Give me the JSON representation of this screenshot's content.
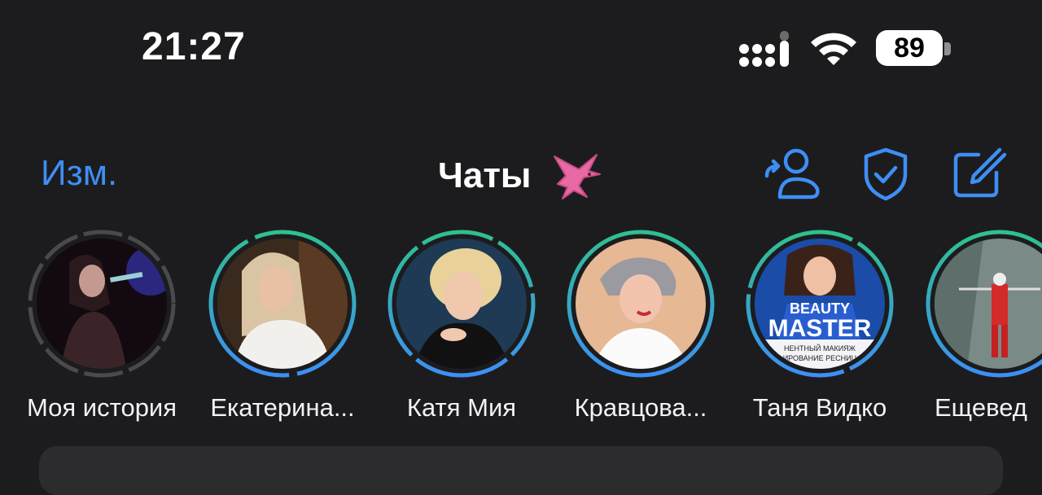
{
  "status": {
    "time": "21:27",
    "battery": "89",
    "signal_icon": "cellular-signal-icon",
    "wifi_icon": "wifi-icon"
  },
  "header": {
    "edit_label": "Изм.",
    "title": "Чаты",
    "title_emoji": "dragon-icon",
    "actions": [
      "add-contact-icon",
      "shield-check-icon",
      "compose-icon"
    ]
  },
  "colors": {
    "accent": "#3d8ff5",
    "background": "#1c1c1e",
    "story_ring_green": "#2fc08f",
    "story_ring_blue": "#3d8ff5",
    "story_ring_seen": "#4a4a4c"
  },
  "stories": [
    {
      "label": "Моя история",
      "seen": true
    },
    {
      "label": "Екатерина...",
      "seen": false
    },
    {
      "label": "Катя Мия",
      "seen": false
    },
    {
      "label": "Кравцова...",
      "seen": false
    },
    {
      "label": "Таня Видко",
      "seen": false
    },
    {
      "label": "Ещевед",
      "seen": false
    }
  ],
  "story_overlay": {
    "beauty": "BEAUTY",
    "master": "MASTER",
    "line1": "НЕНТНЫЙ МАКИЯЖ",
    "line2": "ИРОВАНИЕ РЕСНИЦ"
  }
}
